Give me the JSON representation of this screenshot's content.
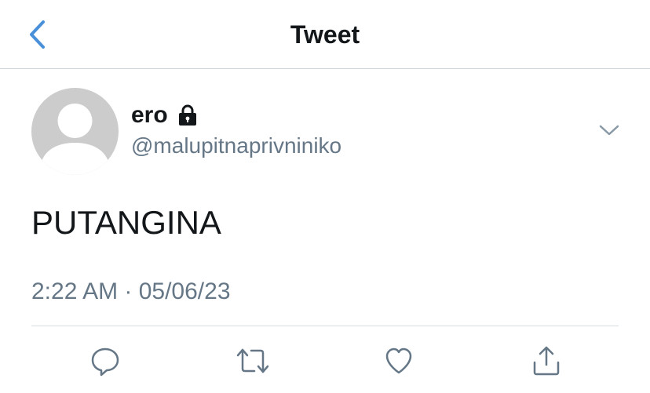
{
  "nav": {
    "title": "Tweet",
    "back_icon": "chevron-left-icon",
    "accent_color": "#4a90d9"
  },
  "tweet": {
    "author_name": "ero",
    "author_handle": "@malupitnaprivniniko",
    "protected_icon": "lock-icon",
    "text": "PUTANGINA",
    "timestamp": "2:22 AM · 05/06/23",
    "more_icon": "chevron-down-icon"
  },
  "actions": [
    {
      "icon": "reply-icon"
    },
    {
      "icon": "retweet-icon"
    },
    {
      "icon": "like-icon"
    },
    {
      "icon": "share-icon"
    }
  ],
  "colors": {
    "text_primary": "#14171a",
    "text_secondary": "#657786",
    "avatar_placeholder": "#cccccc",
    "icon_gray": "#657786"
  }
}
